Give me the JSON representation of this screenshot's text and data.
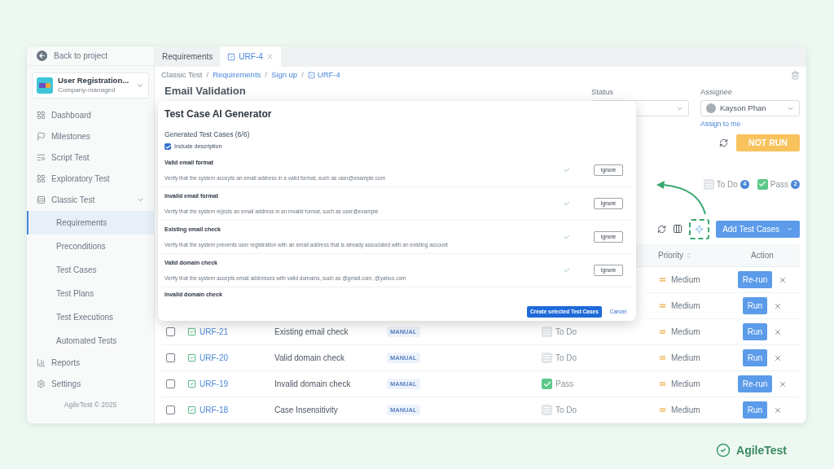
{
  "sidebar": {
    "back": "Back to project",
    "project": {
      "name": "User Registration...",
      "type": "Company-managed"
    },
    "items": [
      {
        "label": "Dashboard",
        "selected": false
      },
      {
        "label": "Milestones",
        "selected": false
      },
      {
        "label": "Script Test",
        "selected": false
      },
      {
        "label": "Exploratory Test",
        "selected": false
      },
      {
        "label": "Classic Test",
        "selected": false,
        "children": [
          {
            "label": "Requirements",
            "selected": true
          },
          {
            "label": "Preconditions",
            "selected": false
          },
          {
            "label": "Test Cases",
            "selected": false
          },
          {
            "label": "Test Plans",
            "selected": false
          },
          {
            "label": "Test Executions",
            "selected": false
          },
          {
            "label": "Automated Tests",
            "selected": false
          }
        ]
      },
      {
        "label": "Reports",
        "selected": false
      },
      {
        "label": "Settings",
        "selected": false
      }
    ],
    "footer": "AgileTest © 2025"
  },
  "tabs": [
    {
      "label": "Requirements",
      "kind": "plain",
      "selected": false
    },
    {
      "label": "URF-4",
      "kind": "issue",
      "selected": true
    }
  ],
  "breadcrumb": [
    {
      "label": "Classic Test",
      "kind": "text"
    },
    {
      "label": "/",
      "kind": "separator"
    },
    {
      "label": "Requirements",
      "kind": "link"
    },
    {
      "label": "/",
      "kind": "separator"
    },
    {
      "label": "Sign up",
      "kind": "link"
    },
    {
      "label": "/",
      "kind": "separator"
    },
    {
      "label": "URF-4",
      "kind": "issue"
    }
  ],
  "title": "Email Validation",
  "status_field": {
    "label": "Status"
  },
  "assignee_field": {
    "label": "Assignee",
    "value": "Kayson Phan",
    "link": "Assign to me"
  },
  "run_status": "NOT RUN",
  "legend": [
    {
      "label": "To Do",
      "count": "4",
      "kind": "todo"
    },
    {
      "label": "Pass",
      "count": "2",
      "kind": "pass"
    }
  ],
  "add_button": "Add Test Cases",
  "table": {
    "columns": [
      {
        "label": "Priority",
        "sortable": true
      },
      {
        "label": "Action",
        "sortable": false
      }
    ],
    "rows": [
      {
        "priority": "Medium",
        "action": "Re-run"
      },
      {
        "priority": "Medium",
        "action": "Run"
      },
      {
        "checked": false,
        "key": "URF-21",
        "summary": "Existing email check",
        "type": "MANUAL",
        "status": "To Do",
        "passed": false,
        "priority": "Medium",
        "action": "Run"
      },
      {
        "checked": false,
        "key": "URF-20",
        "summary": "Valid domain check",
        "type": "MANUAL",
        "status": "To Do",
        "passed": false,
        "priority": "Medium",
        "action": "Run"
      },
      {
        "checked": false,
        "key": "URF-19",
        "summary": "Invalid domain check",
        "type": "MANUAL",
        "status": "Pass",
        "passed": true,
        "priority": "Medium",
        "action": "Re-run"
      },
      {
        "checked": false,
        "key": "URF-18",
        "summary": "Case Insensitivity",
        "type": "MANUAL",
        "status": "To Do",
        "passed": false,
        "priority": "Medium",
        "action": "Run"
      }
    ]
  },
  "modal": {
    "title": "Test Case AI Generator",
    "subtitle": "Generated Test Cases (6/6)",
    "include_description": {
      "label": "Include description",
      "checked": true
    },
    "items": [
      {
        "title": "Valid email format",
        "description": "Verify that the system accepts an email address in a valid format, such as user@example.com",
        "accepted": true,
        "button": "Ignore"
      },
      {
        "title": "Invalid email format",
        "description": "Verify that the system rejects an email address in an invalid format, such as user@example",
        "accepted": true,
        "button": "Ignore"
      },
      {
        "title": "Existing email check",
        "description": "Verify that the system prevents user registration with an email address that is already associated with an existing account",
        "accepted": true,
        "button": "Ignore"
      },
      {
        "title": "Valid domain check",
        "description": "Verify that the system accepts email addresses with valid domains, such as @gmail.com, @yahoo.com",
        "accepted": true,
        "button": "Ignore"
      },
      {
        "title": "Invalid domain check"
      }
    ],
    "primary": "Create selected Test Cases",
    "cancel": "Cancel"
  },
  "brand": "AgileTest"
}
